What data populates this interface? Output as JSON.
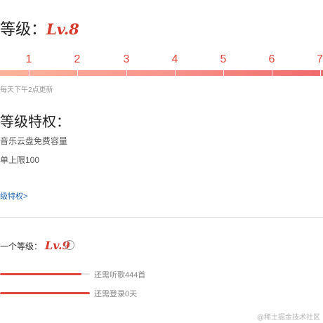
{
  "level_title": {
    "prefix": "等级：",
    "level": "Lv.8"
  },
  "scale": {
    "ticks": [
      "1",
      "2",
      "3",
      "4",
      "5",
      "6",
      "7"
    ]
  },
  "update_note": "每天下午2点更新",
  "privileges": {
    "title": "等级特权：",
    "items": [
      "音乐云盘免费容量",
      "单上限100"
    ],
    "link_label": "级特权>"
  },
  "next_level": {
    "prefix": "一个等级：",
    "level": "Lv.9",
    "info_icon": "i",
    "requirements": [
      {
        "label": "还需听歌444首",
        "progress": 0.91
      },
      {
        "label": "还需登录0天",
        "progress": 1.0
      }
    ]
  },
  "watermark": "@稀土掘金技术社区",
  "colors": {
    "accent": "#e0463b",
    "bar_start": "#fbb39a",
    "bar_end": "#f06a6a",
    "link": "#1a63b8"
  }
}
